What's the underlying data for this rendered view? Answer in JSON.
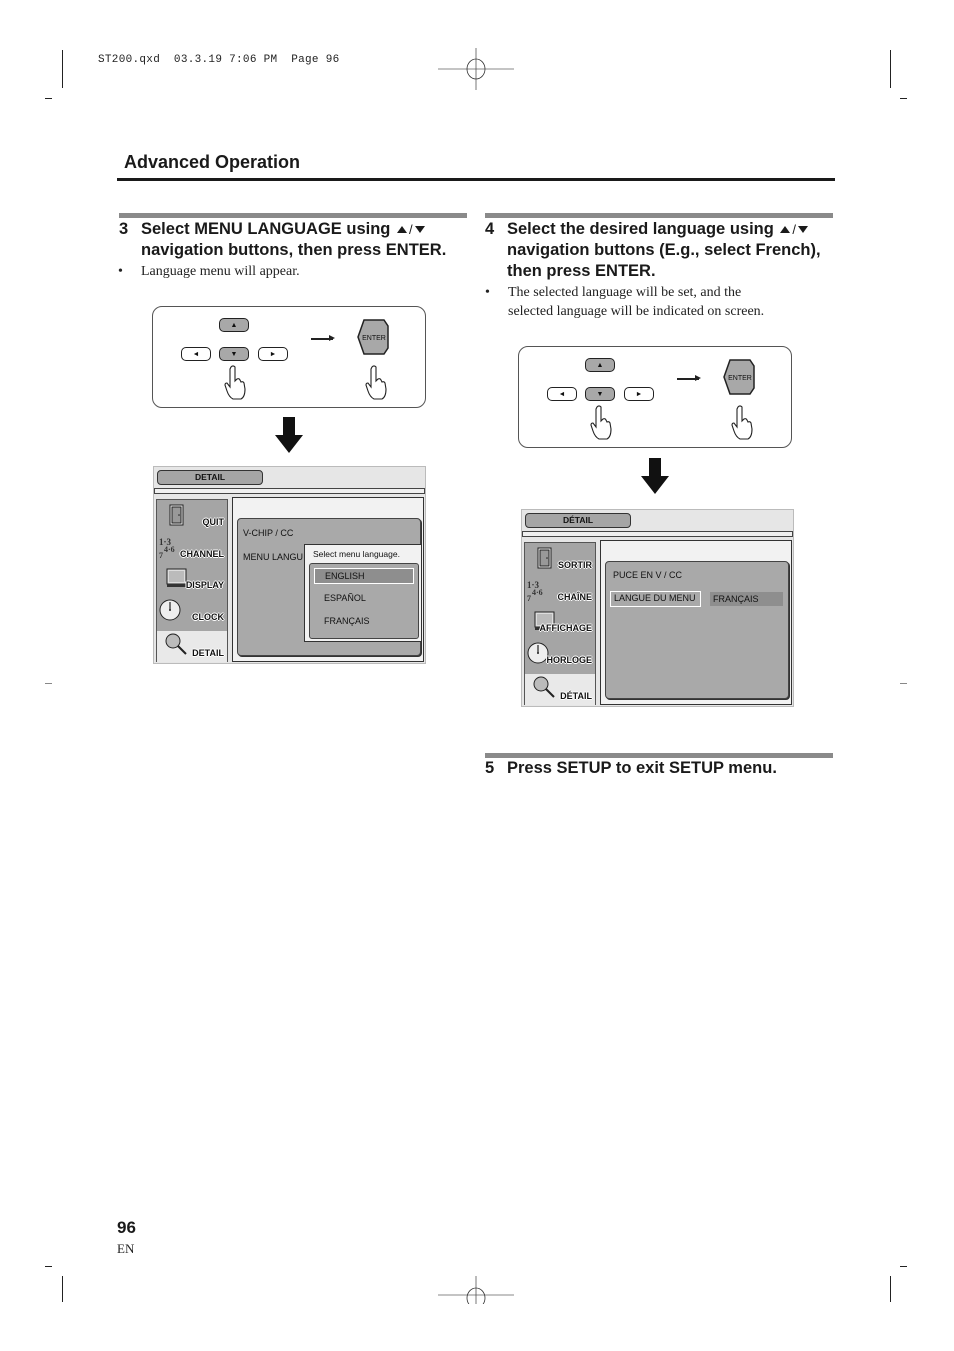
{
  "print_slug": "ST200.qxd  03.3.19 7:06 PM  Page 96",
  "section_title": "Advanced Operation",
  "steps": [
    {
      "number": "3",
      "heading_line1_pre": "Select MENU LANGUAGE using",
      "heading_line2": "navigation buttons, then press ENTER.",
      "bullets": [
        "Language menu will appear."
      ]
    },
    {
      "number": "4",
      "heading_line1_pre": "Select the desired language using",
      "heading_line2": "navigation buttons (E.g., select French),",
      "heading_line3": "then press ENTER.",
      "bullets": [
        "The selected language will be set, and the",
        "selected language will be indicated on screen."
      ]
    },
    {
      "number": "5",
      "heading_line1_pre": "Press SETUP to exit SETUP menu."
    }
  ],
  "slash": "/",
  "bullet_char": "•",
  "remote": {
    "up_key": "▲",
    "down_key": "▼",
    "left_key": "◄",
    "right_key": "►",
    "enter_key": "ENTER"
  },
  "osd_english": {
    "tab": "DETAIL",
    "side_items": [
      {
        "label": "QUIT",
        "icon": "door-icon"
      },
      {
        "label": "CHANNEL",
        "icon": "channel-numbers-icon"
      },
      {
        "label": "DISPLAY",
        "icon": "monitor-icon"
      },
      {
        "label": "CLOCK",
        "icon": "clock-icon"
      },
      {
        "label": "DETAIL",
        "icon": "magnifier-icon",
        "active": true
      }
    ],
    "rows": [
      "V-CHIP / CC",
      "MENU LANGU"
    ],
    "popup": {
      "title": "Select menu language.",
      "options": [
        "ENGLISH",
        "ESPAÑOL",
        "FRANÇAIS"
      ],
      "selected": "ENGLISH"
    }
  },
  "osd_french": {
    "tab": "DÉTAIL",
    "side_items": [
      {
        "label": "SORTIR",
        "icon": "door-icon"
      },
      {
        "label": "CHAÎNE",
        "icon": "channel-numbers-icon"
      },
      {
        "label": "AFFICHAGE",
        "icon": "monitor-icon"
      },
      {
        "label": "HORLOGE",
        "icon": "clock-icon"
      },
      {
        "label": "DÉTAIL",
        "icon": "magnifier-icon",
        "active": true
      }
    ],
    "rows": [
      "PUCE EN V / CC",
      "LANGUE DU MENU"
    ],
    "menu_language_value": "FRANÇAIS"
  },
  "footer": {
    "page_number": "96",
    "language_code": "EN"
  }
}
